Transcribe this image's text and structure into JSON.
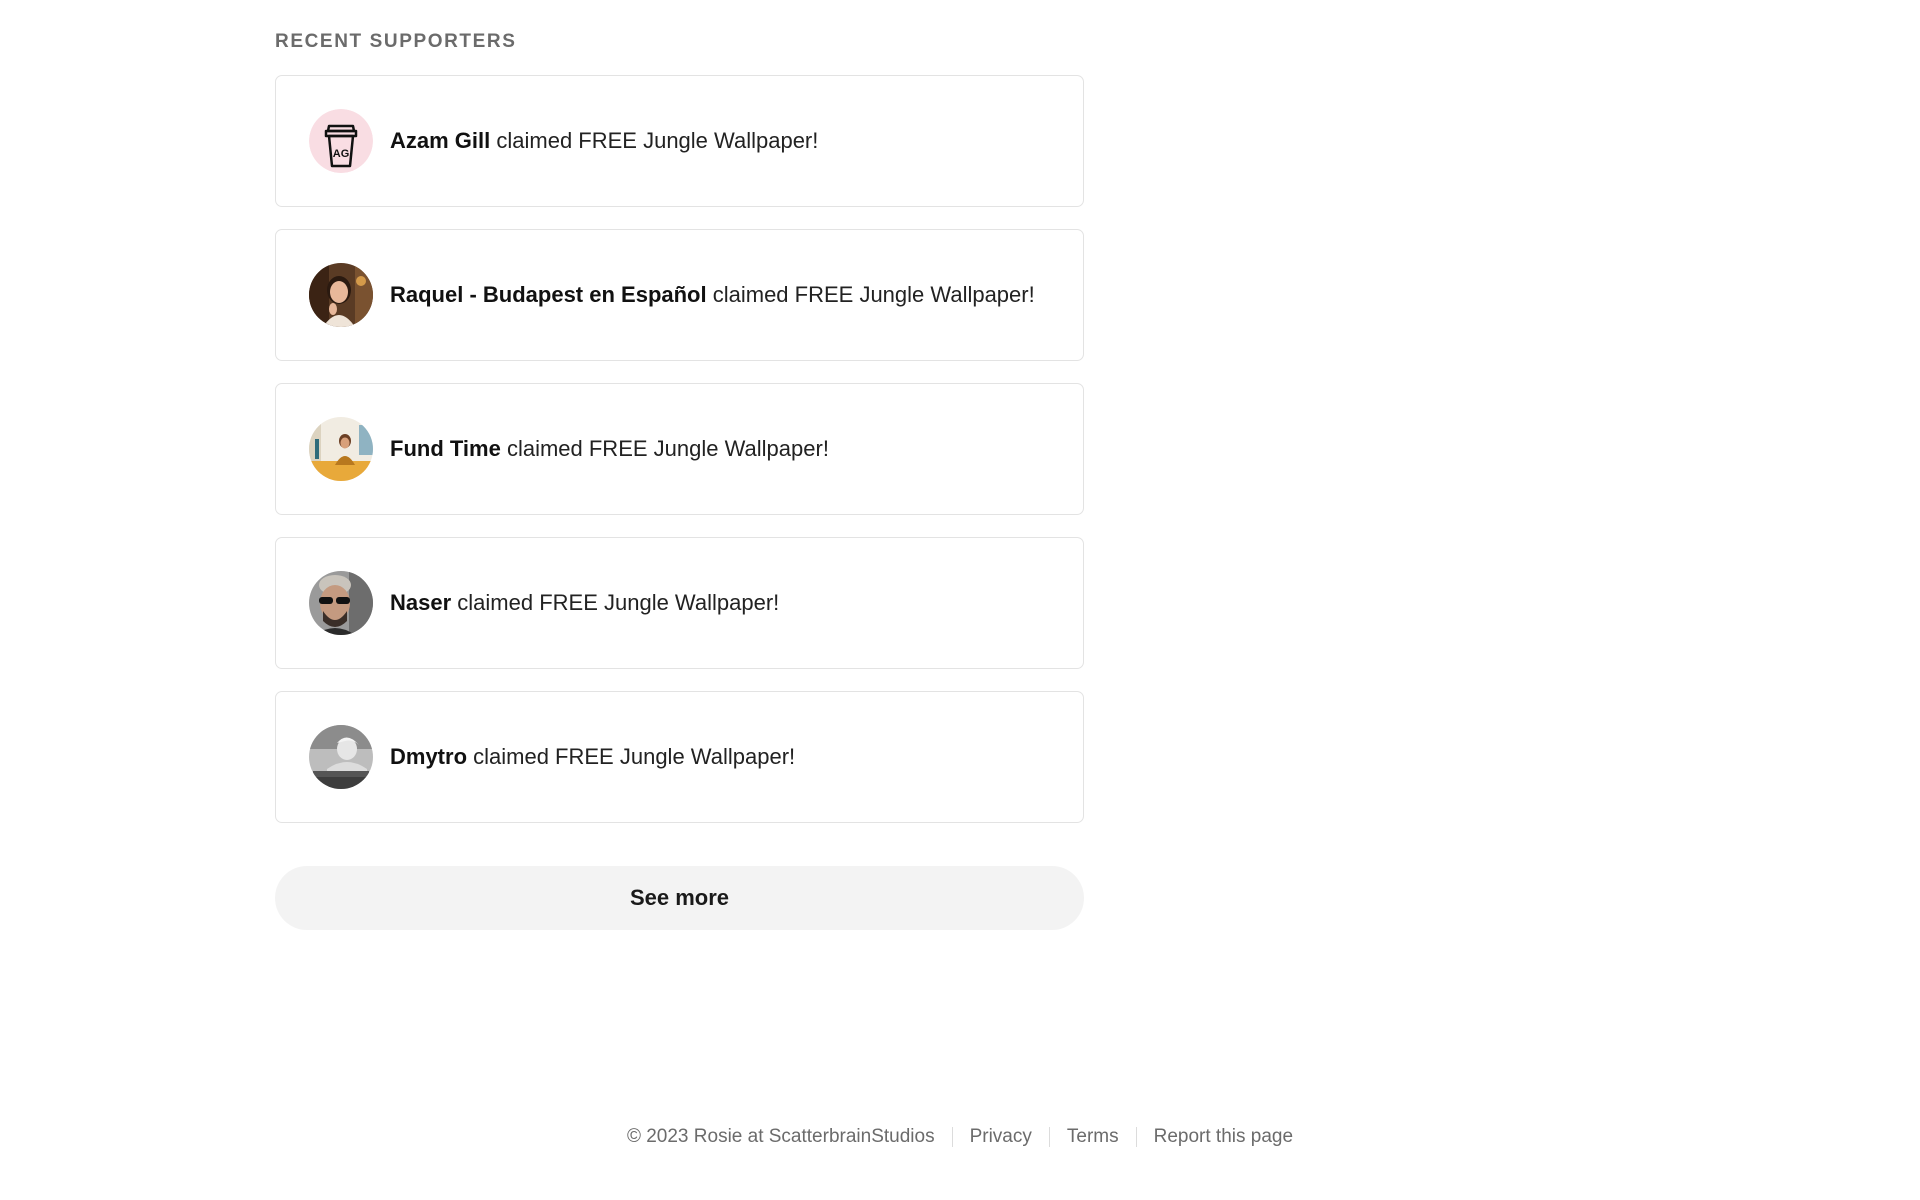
{
  "section": {
    "title": "RECENT SUPPORTERS"
  },
  "supporters": [
    {
      "name": "Azam Gill",
      "action": "claimed FREE Jungle Wallpaper!",
      "avatar_icon": "coffee-cup-logo-avatar"
    },
    {
      "name": "Raquel - Budapest en Español",
      "action": "claimed FREE Jungle Wallpaper!",
      "avatar_icon": "photo-avatar"
    },
    {
      "name": "Fund Time",
      "action": "claimed FREE Jungle Wallpaper!",
      "avatar_icon": "photo-avatar"
    },
    {
      "name": "Naser",
      "action": "claimed FREE Jungle Wallpaper!",
      "avatar_icon": "photo-avatar"
    },
    {
      "name": "Dmytro",
      "action": "claimed FREE Jungle Wallpaper!",
      "avatar_icon": "photo-avatar"
    }
  ],
  "see_more": {
    "label": "See more"
  },
  "footer": {
    "copyright": "© 2023 Rosie at ScatterbrainStudios",
    "links": [
      "Privacy",
      "Terms",
      "Report this page"
    ]
  },
  "colors": {
    "card_border": "#e3e3e3",
    "button_bg": "#f3f3f3",
    "muted_text": "#6b6b6b",
    "avatar_pink": "#f9dde3"
  }
}
